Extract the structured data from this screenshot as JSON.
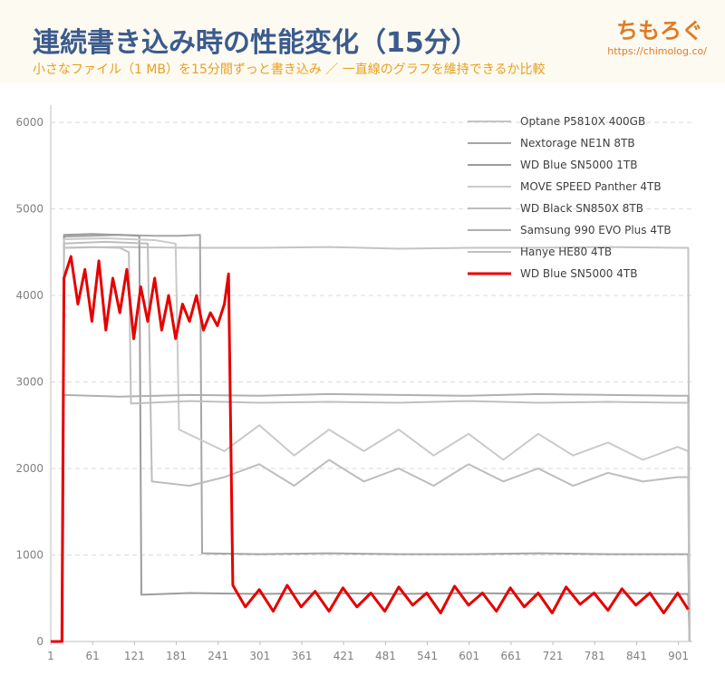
{
  "header": {
    "title": "連続書き込み時の性能変化（15分）",
    "subtitle": "小さなファイル（1 MB）を15分間ずっと書き込み ／ 一直線のグラフを維持できるか比較",
    "logo_text": "ちもろぐ",
    "logo_url": "https://chimolog.co/"
  },
  "colors": {
    "title": "#3b5b8c",
    "subtitle": "#e8a020",
    "logo": "#e07b23",
    "highlight": "#e60000",
    "gray_series": "#b4b4b4",
    "grid": "#d9d9d9",
    "axis_text": "#808080"
  },
  "chart_data": {
    "type": "line",
    "title": "",
    "xlabel": "",
    "ylabel": "",
    "xlim": [
      1,
      921
    ],
    "ylim": [
      0,
      6200
    ],
    "x_ticks": [
      "1",
      "61",
      "121",
      "181",
      "241",
      "301",
      "361",
      "421",
      "481",
      "541",
      "601",
      "661",
      "721",
      "781",
      "841",
      "901"
    ],
    "y_ticks": [
      "0",
      "1000",
      "2000",
      "3000",
      "4000",
      "5000",
      "6000"
    ],
    "grid": "horizontal",
    "legend_position": "top-right",
    "series": [
      {
        "name": "Optane P5810X 400GB",
        "points": [
          [
            1,
            0
          ],
          [
            18,
            0
          ],
          [
            20,
            4550
          ],
          [
            100,
            4560
          ],
          [
            200,
            4550
          ],
          [
            300,
            4550
          ],
          [
            400,
            4560
          ],
          [
            500,
            4540
          ],
          [
            600,
            4550
          ],
          [
            700,
            4550
          ],
          [
            800,
            4560
          ],
          [
            900,
            4550
          ],
          [
            915,
            4550
          ],
          [
            917,
            0
          ]
        ]
      },
      {
        "name": "Nextorage NE1N 8TB",
        "points": [
          [
            1,
            0
          ],
          [
            18,
            0
          ],
          [
            20,
            4680
          ],
          [
            60,
            4690
          ],
          [
            100,
            4700
          ],
          [
            150,
            4690
          ],
          [
            185,
            4690
          ],
          [
            215,
            4700
          ],
          [
            218,
            1020
          ],
          [
            300,
            1010
          ],
          [
            400,
            1020
          ],
          [
            500,
            1010
          ],
          [
            600,
            1010
          ],
          [
            700,
            1020
          ],
          [
            800,
            1010
          ],
          [
            900,
            1010
          ],
          [
            915,
            1010
          ],
          [
            917,
            0
          ]
        ]
      },
      {
        "name": "WD Blue SN5000 1TB",
        "points": [
          [
            1,
            0
          ],
          [
            18,
            0
          ],
          [
            20,
            4700
          ],
          [
            60,
            4710
          ],
          [
            100,
            4700
          ],
          [
            128,
            4690
          ],
          [
            131,
            540
          ],
          [
            200,
            560
          ],
          [
            300,
            550
          ],
          [
            400,
            560
          ],
          [
            500,
            550
          ],
          [
            600,
            560
          ],
          [
            700,
            550
          ],
          [
            800,
            560
          ],
          [
            900,
            550
          ],
          [
            915,
            550
          ],
          [
            917,
            0
          ]
        ]
      },
      {
        "name": "MOVE SPEED Panther 4TB",
        "points": [
          [
            1,
            0
          ],
          [
            18,
            0
          ],
          [
            20,
            4650
          ],
          [
            80,
            4660
          ],
          [
            150,
            4640
          ],
          [
            180,
            4600
          ],
          [
            185,
            2450
          ],
          [
            250,
            2200
          ],
          [
            300,
            2500
          ],
          [
            350,
            2150
          ],
          [
            400,
            2450
          ],
          [
            450,
            2200
          ],
          [
            500,
            2450
          ],
          [
            550,
            2150
          ],
          [
            600,
            2400
          ],
          [
            650,
            2100
          ],
          [
            700,
            2400
          ],
          [
            750,
            2150
          ],
          [
            800,
            2300
          ],
          [
            850,
            2100
          ],
          [
            900,
            2250
          ],
          [
            915,
            2200
          ],
          [
            917,
            0
          ]
        ]
      },
      {
        "name": "WD Black SN850X 8TB",
        "points": [
          [
            1,
            0
          ],
          [
            18,
            0
          ],
          [
            20,
            4600
          ],
          [
            80,
            4620
          ],
          [
            140,
            4600
          ],
          [
            146,
            1850
          ],
          [
            200,
            1800
          ],
          [
            250,
            1900
          ],
          [
            300,
            2050
          ],
          [
            350,
            1800
          ],
          [
            400,
            2100
          ],
          [
            450,
            1850
          ],
          [
            500,
            2000
          ],
          [
            550,
            1800
          ],
          [
            600,
            2050
          ],
          [
            650,
            1850
          ],
          [
            700,
            2000
          ],
          [
            750,
            1800
          ],
          [
            800,
            1950
          ],
          [
            850,
            1850
          ],
          [
            900,
            1900
          ],
          [
            915,
            1900
          ],
          [
            917,
            0
          ]
        ]
      },
      {
        "name": "Samsung 990 EVO Plus 4TB",
        "points": [
          [
            1,
            0
          ],
          [
            18,
            0
          ],
          [
            20,
            2850
          ],
          [
            100,
            2830
          ],
          [
            200,
            2850
          ],
          [
            300,
            2840
          ],
          [
            400,
            2860
          ],
          [
            500,
            2850
          ],
          [
            600,
            2840
          ],
          [
            700,
            2860
          ],
          [
            800,
            2850
          ],
          [
            900,
            2840
          ],
          [
            915,
            2840
          ],
          [
            917,
            0
          ]
        ]
      },
      {
        "name": "Hanye HE80 4TB",
        "points": [
          [
            1,
            0
          ],
          [
            18,
            0
          ],
          [
            20,
            4550
          ],
          [
            60,
            4560
          ],
          [
            100,
            4550
          ],
          [
            113,
            4500
          ],
          [
            116,
            2750
          ],
          [
            200,
            2780
          ],
          [
            300,
            2760
          ],
          [
            400,
            2770
          ],
          [
            500,
            2760
          ],
          [
            600,
            2780
          ],
          [
            700,
            2760
          ],
          [
            800,
            2770
          ],
          [
            900,
            2760
          ],
          [
            915,
            2760
          ],
          [
            917,
            0
          ]
        ]
      },
      {
        "name": "WD Blue SN5000 4TB",
        "points": [
          [
            1,
            0
          ],
          [
            17,
            0
          ],
          [
            20,
            4200
          ],
          [
            30,
            4450
          ],
          [
            40,
            3900
          ],
          [
            50,
            4300
          ],
          [
            60,
            3700
          ],
          [
            70,
            4400
          ],
          [
            80,
            3600
          ],
          [
            90,
            4200
          ],
          [
            100,
            3800
          ],
          [
            110,
            4300
          ],
          [
            120,
            3500
          ],
          [
            130,
            4100
          ],
          [
            140,
            3700
          ],
          [
            150,
            4200
          ],
          [
            160,
            3600
          ],
          [
            170,
            4000
          ],
          [
            180,
            3500
          ],
          [
            190,
            3900
          ],
          [
            200,
            3700
          ],
          [
            210,
            4000
          ],
          [
            220,
            3600
          ],
          [
            230,
            3800
          ],
          [
            240,
            3650
          ],
          [
            250,
            3900
          ],
          [
            256,
            4250
          ],
          [
            262,
            650
          ],
          [
            280,
            400
          ],
          [
            300,
            600
          ],
          [
            320,
            350
          ],
          [
            340,
            650
          ],
          [
            360,
            400
          ],
          [
            380,
            580
          ],
          [
            400,
            350
          ],
          [
            420,
            620
          ],
          [
            440,
            400
          ],
          [
            460,
            560
          ],
          [
            480,
            350
          ],
          [
            500,
            630
          ],
          [
            520,
            420
          ],
          [
            540,
            560
          ],
          [
            560,
            330
          ],
          [
            580,
            640
          ],
          [
            600,
            420
          ],
          [
            620,
            560
          ],
          [
            640,
            350
          ],
          [
            660,
            620
          ],
          [
            680,
            400
          ],
          [
            700,
            560
          ],
          [
            720,
            330
          ],
          [
            740,
            630
          ],
          [
            760,
            430
          ],
          [
            780,
            560
          ],
          [
            800,
            360
          ],
          [
            820,
            610
          ],
          [
            840,
            420
          ],
          [
            860,
            560
          ],
          [
            880,
            330
          ],
          [
            900,
            560
          ],
          [
            915,
            370
          ]
        ]
      }
    ]
  }
}
